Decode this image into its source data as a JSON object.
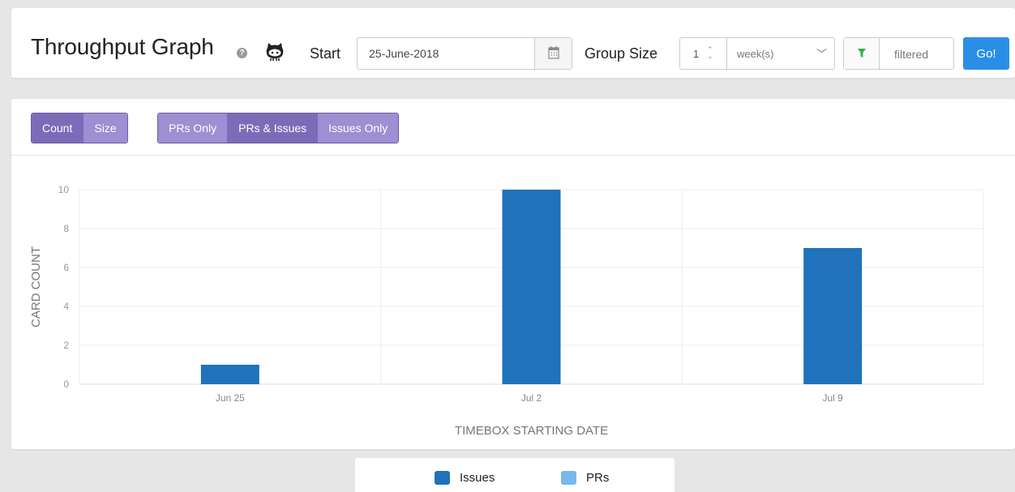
{
  "header": {
    "title": "Throughput Graph",
    "help_icon": "question-circle-icon",
    "github_icon": "github-octocat-icon",
    "start_label": "Start",
    "start_value": "25-June-2018",
    "calendar_icon": "calendar-icon",
    "group_size_label": "Group Size",
    "group_size_value": "1",
    "group_unit_value": "week(s)",
    "filter_icon": "filter-icon",
    "filter_value": "filtered",
    "go_label": "Go!"
  },
  "toolbar": {
    "metric_buttons": [
      {
        "label": "Count",
        "active": true
      },
      {
        "label": "Size",
        "active": false
      }
    ],
    "scope_buttons": [
      {
        "label": "PRs Only",
        "active": false
      },
      {
        "label": "PRs & Issues",
        "active": true
      },
      {
        "label": "Issues Only",
        "active": false
      }
    ]
  },
  "colors": {
    "issues": "#1f72bb",
    "prs": "#75b9ed",
    "button_active": "#7c6cb8",
    "button": "#9d8fd2",
    "go": "#2a8ee7"
  },
  "chart_data": {
    "type": "bar",
    "categories": [
      "Jun 25",
      "Jul 2",
      "Jul 9"
    ],
    "series": [
      {
        "name": "Issues",
        "values": [
          1,
          10,
          7
        ]
      },
      {
        "name": "PRs",
        "values": [
          0,
          0,
          0
        ]
      }
    ],
    "xlabel": "TIMEBOX STARTING DATE",
    "ylabel": "CARD COUNT",
    "ylim": [
      0,
      10
    ],
    "yticks": [
      0,
      2,
      4,
      6,
      8,
      10
    ],
    "grid": true,
    "legend": "bottom"
  }
}
